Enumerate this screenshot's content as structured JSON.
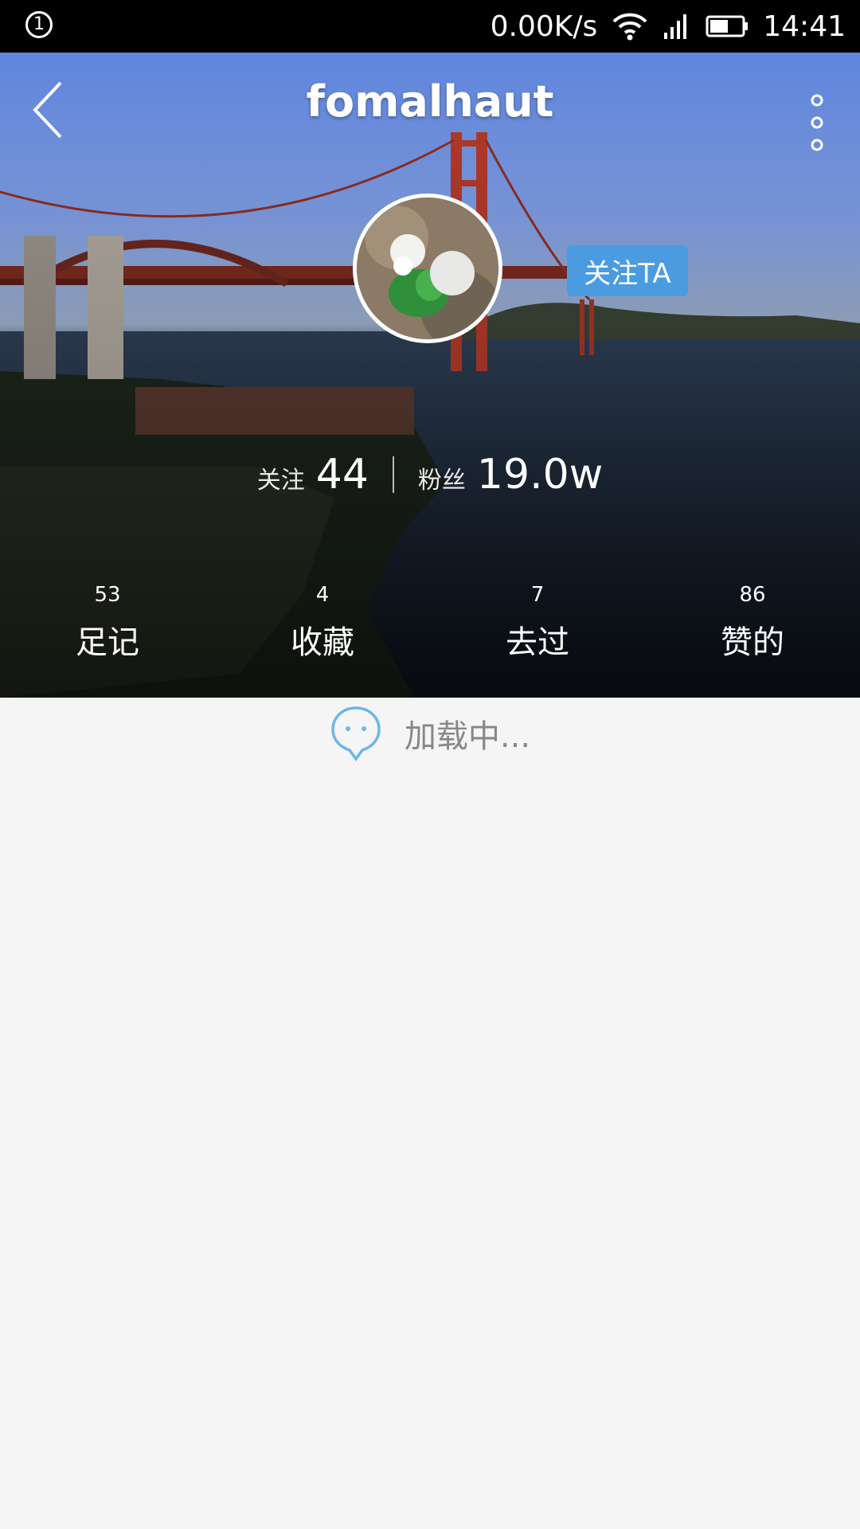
{
  "statusbar": {
    "notification_badge": "1",
    "network_speed": "0.00K/s",
    "time": "14:41"
  },
  "header": {
    "title": "fomalhaut"
  },
  "profile": {
    "follow_button": "关注TA",
    "following_label": "关注",
    "following_count": "44",
    "followers_label": "粉丝",
    "followers_count": "19.0w"
  },
  "tabs": [
    {
      "count": "53",
      "label": "足记"
    },
    {
      "count": "4",
      "label": "收藏"
    },
    {
      "count": "7",
      "label": "去过"
    },
    {
      "count": "86",
      "label": "赞的"
    }
  ],
  "loading": {
    "text": "加载中..."
  }
}
